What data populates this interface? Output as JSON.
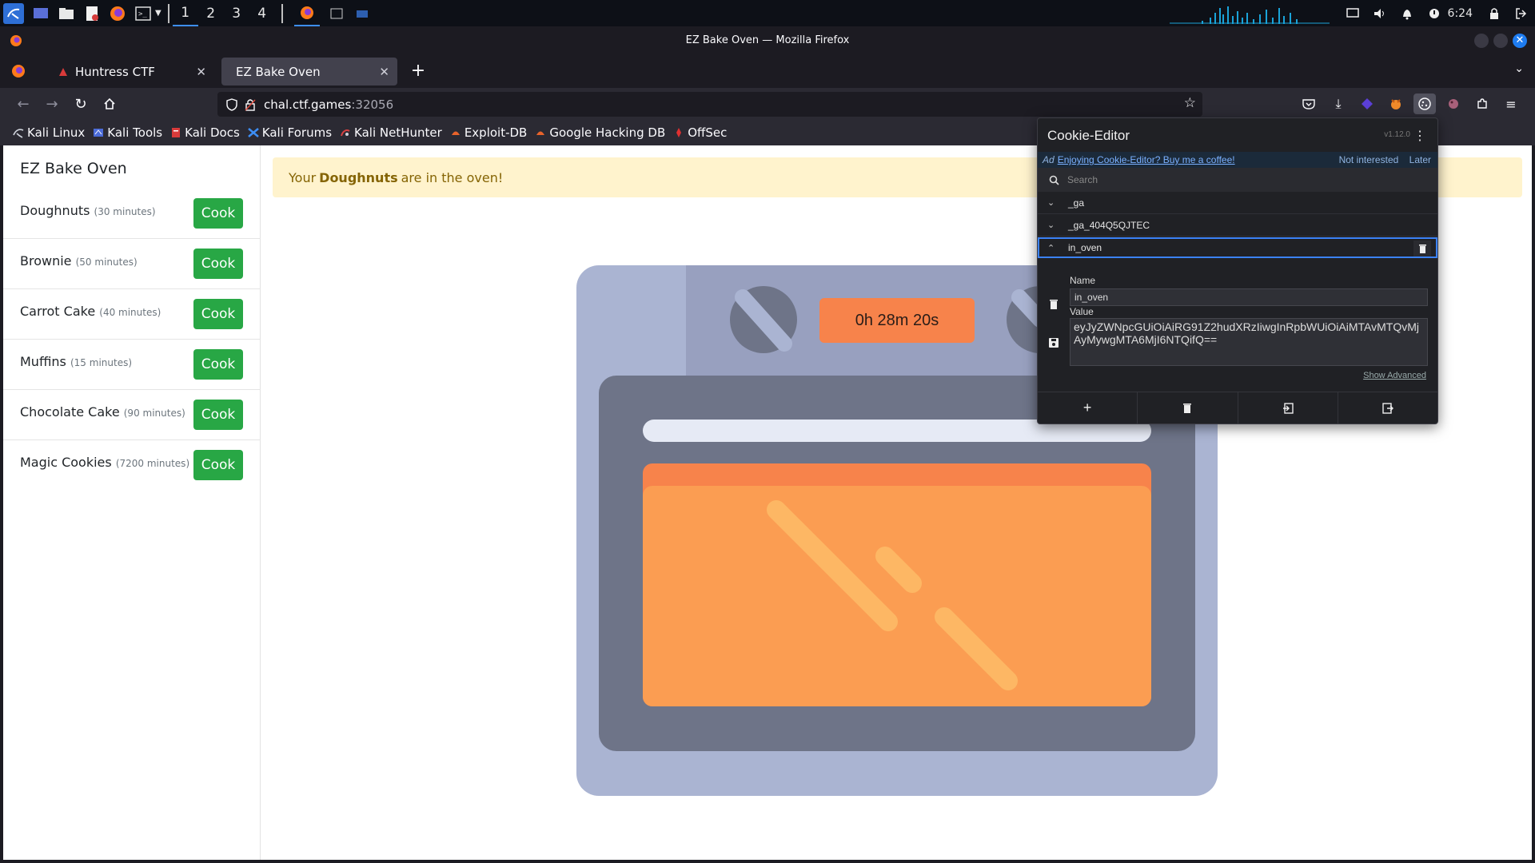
{
  "panel": {
    "workspaces": [
      "1",
      "2",
      "3",
      "4"
    ],
    "active_workspace": "1",
    "clock": "6:24"
  },
  "window": {
    "title": "EZ Bake Oven — Mozilla Firefox"
  },
  "tabs": [
    {
      "label": "Huntress CTF",
      "active": false
    },
    {
      "label": "EZ Bake Oven",
      "active": true
    }
  ],
  "urlbar": {
    "host": "chal.ctf.games",
    "port": ":32056"
  },
  "bookmarks": [
    {
      "label": "Kali Linux",
      "icon": "kali-dragon-icon"
    },
    {
      "label": "Kali Tools",
      "icon": "kali-tools-icon"
    },
    {
      "label": "Kali Docs",
      "icon": "kali-docs-icon"
    },
    {
      "label": "Kali Forums",
      "icon": "kali-forums-icon"
    },
    {
      "label": "Kali NetHunter",
      "icon": "nethunter-icon"
    },
    {
      "label": "Exploit-DB",
      "icon": "exploit-db-icon"
    },
    {
      "label": "Google Hacking DB",
      "icon": "ghdb-icon"
    },
    {
      "label": "OffSec",
      "icon": "offsec-icon"
    }
  ],
  "site": {
    "title": "EZ Bake Oven",
    "cook_label": "Cook",
    "items": [
      {
        "name": "Doughnuts",
        "time": "(30 minutes)"
      },
      {
        "name": "Brownie",
        "time": "(50 minutes)"
      },
      {
        "name": "Carrot Cake",
        "time": "(40 minutes)"
      },
      {
        "name": "Muffins",
        "time": "(15 minutes)"
      },
      {
        "name": "Chocolate Cake",
        "time": "(90 minutes)"
      },
      {
        "name": "Magic Cookies",
        "time": "(7200 minutes)"
      }
    ],
    "alert": {
      "prefix": "Your",
      "item": "Doughnuts",
      "suffix": "are in the oven!"
    },
    "timer": "0h 28m 20s"
  },
  "cookie_editor": {
    "title": "Cookie-Editor",
    "version": "v1.12.0",
    "ad": {
      "tag": "Ad",
      "link": "Enjoying Cookie-Editor? Buy me a coffee!",
      "not_interested": "Not interested",
      "later": "Later"
    },
    "search_placeholder": "Search",
    "cookies": [
      "_ga",
      "_ga_404Q5QJTEC",
      "in_oven"
    ],
    "selected": {
      "name_label": "Name",
      "name": "in_oven",
      "value_label": "Value",
      "value": "eyJyZWNpcGUiOiAiRG91Z2hudXRzIiwgInRpbWUiOiAiMTAvMTQvMjAyMywgMTA6MjI6NTQifQ==",
      "show_advanced": "Show Advanced"
    }
  },
  "colors": {
    "cook_button": "#28a745",
    "alert_bg": "#fff3cd",
    "alert_text": "#856404",
    "oven_outer": "#aab4d2",
    "oven_body": "#6e7488",
    "oven_window": "#f7834b",
    "timer_bg": "#f7834b"
  }
}
